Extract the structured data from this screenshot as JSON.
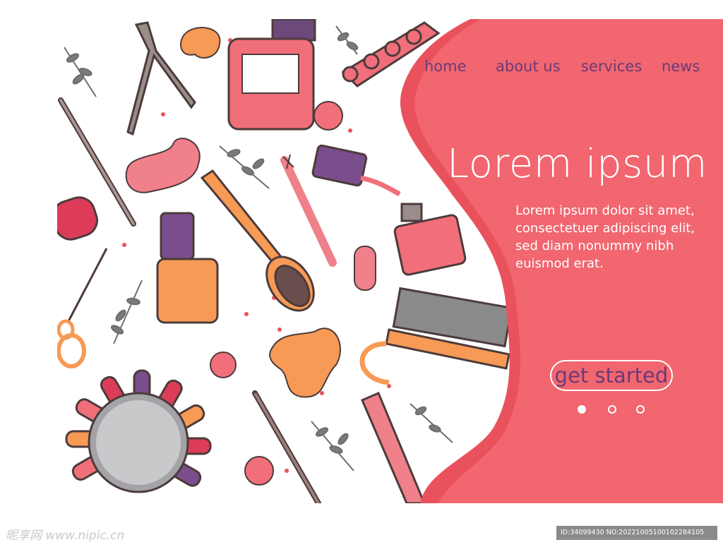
{
  "nav": {
    "items": [
      {
        "label": "home"
      },
      {
        "label": "about us"
      },
      {
        "label": "services"
      },
      {
        "label": "news"
      }
    ]
  },
  "hero": {
    "title": "Lorem ipsum",
    "body_lines": [
      "Lorem ipsum dolor sit amet,",
      "consectetuer adipiscing elit,",
      "sed diam nonummy nibh",
      "euismod erat."
    ],
    "cta_label": "get started"
  },
  "carousel": {
    "count": 3,
    "active_index": 0
  },
  "watermark": {
    "left": "昵享网 www.nipic.cn",
    "right": "ID:34099430 NO:20221005100102284105"
  },
  "colors": {
    "panel": "#f1666f",
    "panel_edge": "#e9525d",
    "nav_text": "#6b3a78",
    "polish_pink": "#f16f7a",
    "polish_orange": "#f79a55",
    "polish_purple": "#7a4d8c",
    "leaf": "#6c6c6c"
  }
}
